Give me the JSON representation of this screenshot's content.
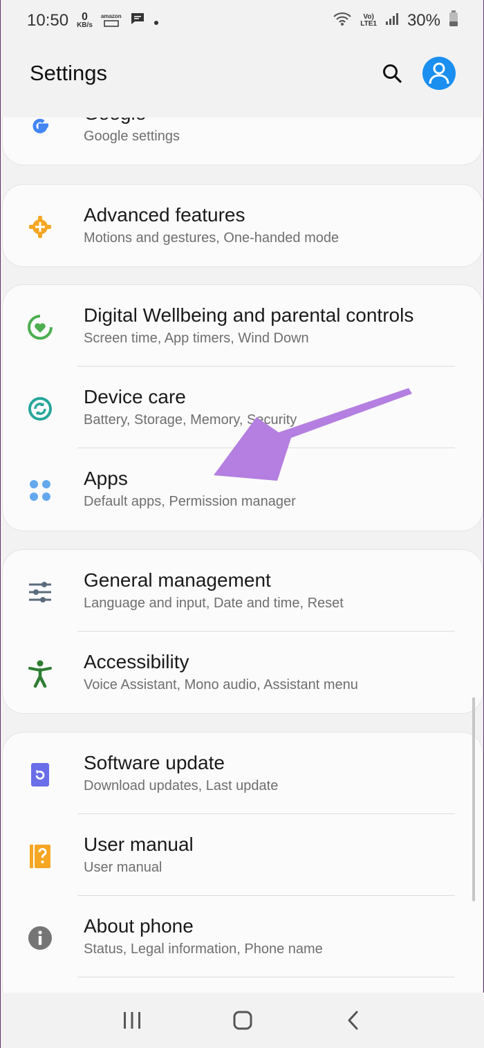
{
  "status_bar": {
    "time": "10:50",
    "data_rate_value": "0",
    "data_rate_unit": "KB/s",
    "amazon_label": "amazon",
    "network_label_top": "Vo)",
    "network_label_bottom": "LTE1",
    "battery": "30%"
  },
  "header": {
    "title": "Settings"
  },
  "cards": [
    {
      "items": [
        {
          "title": "Google",
          "subtitle": "Google settings",
          "icon": "google-icon",
          "color": "#4285f4"
        }
      ]
    },
    {
      "items": [
        {
          "title": "Advanced features",
          "subtitle": "Motions and gestures, One-handed mode",
          "icon": "gear-plus-icon",
          "color": "#f5a623"
        }
      ]
    },
    {
      "items": [
        {
          "title": "Digital Wellbeing and parental controls",
          "subtitle": "Screen time, App timers, Wind Down",
          "icon": "wellbeing-heart-icon",
          "color": "#4caf50"
        },
        {
          "title": "Device care",
          "subtitle": "Battery, Storage, Memory, Security",
          "icon": "device-care-icon",
          "color": "#26a69a"
        },
        {
          "title": "Apps",
          "subtitle": "Default apps, Permission manager",
          "icon": "apps-grid-icon",
          "color": "#64a9ee"
        }
      ]
    },
    {
      "items": [
        {
          "title": "General management",
          "subtitle": "Language and input, Date and time, Reset",
          "icon": "sliders-icon",
          "color": "#5a6b7d"
        },
        {
          "title": "Accessibility",
          "subtitle": "Voice Assistant, Mono audio, Assistant menu",
          "icon": "accessibility-icon",
          "color": "#2e7d32"
        }
      ]
    },
    {
      "items": [
        {
          "title": "Software update",
          "subtitle": "Download updates, Last update",
          "icon": "software-update-icon",
          "color": "#6a6ee8"
        },
        {
          "title": "User manual",
          "subtitle": "User manual",
          "icon": "user-manual-icon",
          "color": "#f5a623"
        },
        {
          "title": "About phone",
          "subtitle": "Status, Legal information, Phone name",
          "icon": "info-icon",
          "color": "#757575"
        }
      ]
    }
  ],
  "annotation": {
    "arrow_color": "#b47fe0"
  }
}
